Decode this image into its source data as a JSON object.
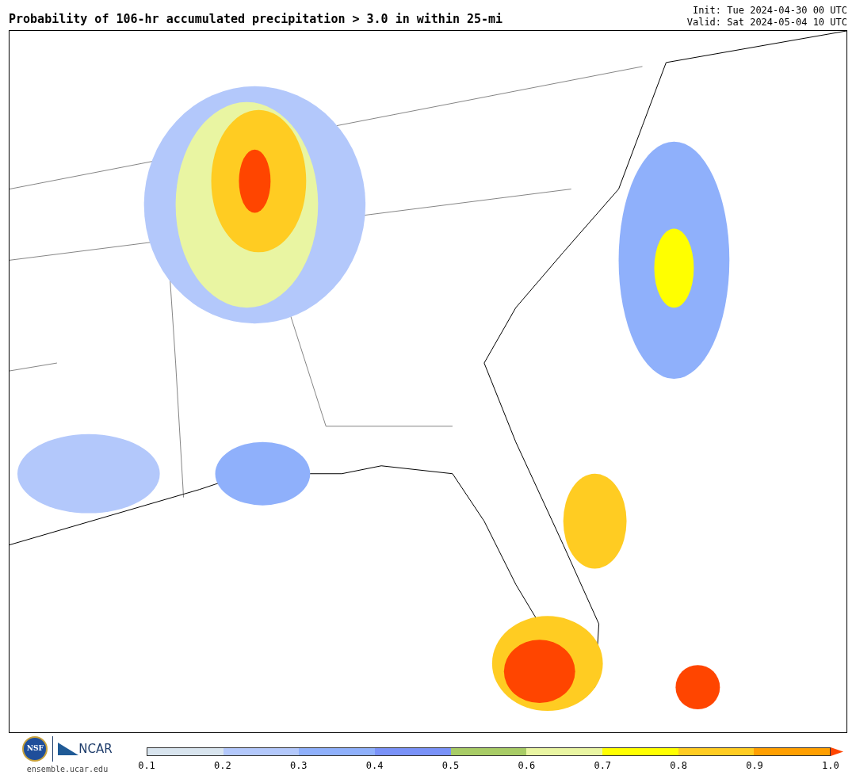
{
  "title": "Probability of 106-hr accumulated precipitation > 3.0 in within 25-mi",
  "init": "Init: Tue 2024-04-30 00 UTC",
  "valid": "Valid: Sat 2024-05-04 10 UTC",
  "logos": {
    "nsf": "NSF",
    "ncar": "NCAR",
    "url": "ensemble.ucar.edu"
  },
  "colorbar": {
    "bins": [
      {
        "kind": "bin",
        "color": "#d8e4ee"
      },
      {
        "kind": "bin",
        "color": "#b3c8fb"
      },
      {
        "kind": "bin",
        "color": "#8fb0fb"
      },
      {
        "kind": "bin",
        "color": "#7a92f8"
      },
      {
        "kind": "bin",
        "color": "#a8cc66"
      },
      {
        "kind": "bin",
        "color": "#e9f5a2"
      },
      {
        "kind": "bin",
        "color": "#ffff00"
      },
      {
        "kind": "bin",
        "color": "#ffcc22"
      },
      {
        "kind": "bin",
        "color": "#ff9f00"
      },
      {
        "kind": "arrow",
        "color": "#ff4500"
      }
    ],
    "ticks": [
      "0.1",
      "0.2",
      "0.3",
      "0.4",
      "0.5",
      "0.6",
      "0.7",
      "0.8",
      "0.9",
      "1.0"
    ]
  }
}
